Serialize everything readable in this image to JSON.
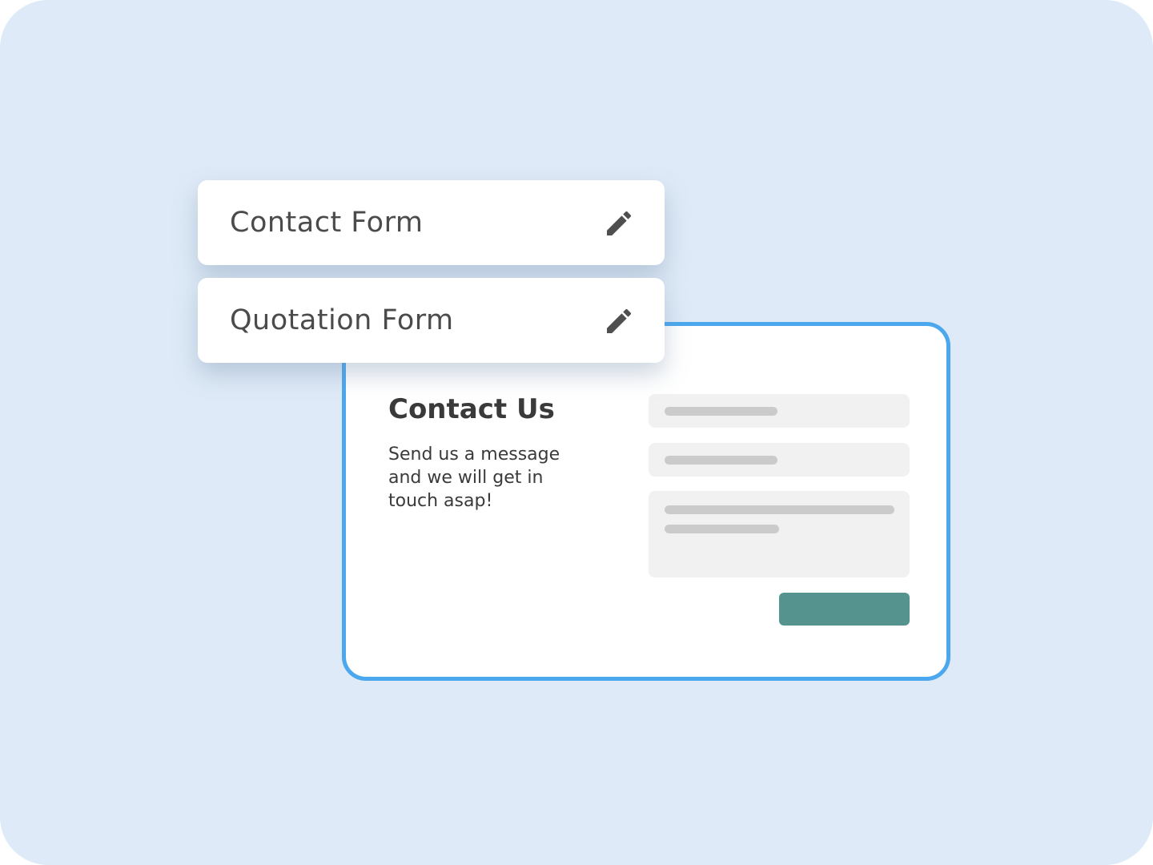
{
  "forms_list": {
    "items": [
      {
        "label": "Contact Form",
        "icon": "pencil-icon"
      },
      {
        "label": "Quotation Form",
        "icon": "pencil-icon"
      }
    ]
  },
  "preview": {
    "title": "Contact Us",
    "description": "Send us a message and we will get in touch asap!"
  },
  "colors": {
    "background": "#deeaf7",
    "preview_border": "#4ba8ee",
    "submit_button": "#55938e",
    "field_background": "#f1f1f1",
    "placeholder_line": "#cbcbcb",
    "text": "#4b4b4b"
  }
}
